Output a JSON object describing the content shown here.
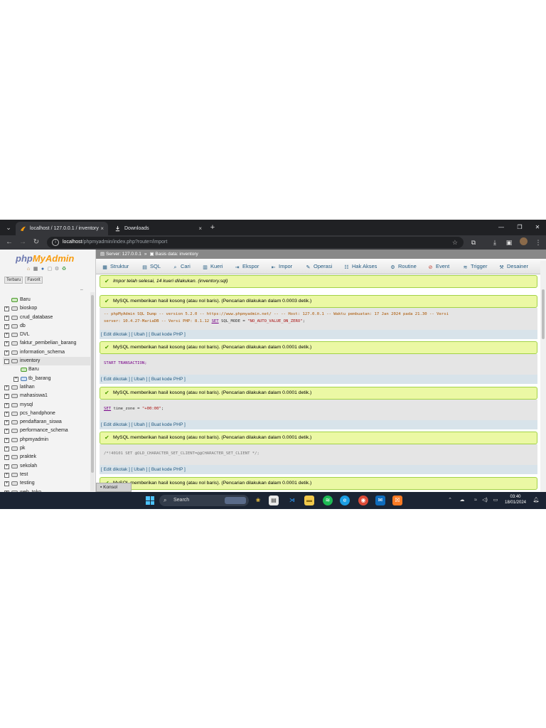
{
  "browser": {
    "tabs": [
      {
        "title": "localhost / 127.0.0.1 / inventory",
        "close": "×"
      },
      {
        "title": "Downloads",
        "close": "×"
      }
    ],
    "new_tab": "+",
    "window_controls": {
      "minimize": "—",
      "restore": "❐",
      "close": "✕"
    },
    "url_host": "localhost",
    "url_path": "/phpmyadmin/index.php?route=/import"
  },
  "pma": {
    "logo_php": "php",
    "logo_myadmin": "MyAdmin",
    "sidebar_tabs": [
      "Terbaru",
      "Favorit"
    ],
    "collapse": "⇔",
    "tree": [
      {
        "label": "Baru",
        "type": "new",
        "expander": ""
      },
      {
        "label": "bioskop",
        "type": "db",
        "expander": "+"
      },
      {
        "label": "crud_database",
        "type": "db",
        "expander": "+"
      },
      {
        "label": "db",
        "type": "db",
        "expander": "+"
      },
      {
        "label": "DVL",
        "type": "db",
        "expander": "+"
      },
      {
        "label": "faktur_pembelian_barang",
        "type": "db",
        "expander": "+"
      },
      {
        "label": "information_schema",
        "type": "db",
        "expander": "+"
      },
      {
        "label": "inventory",
        "type": "db-open",
        "expander": "−"
      },
      {
        "label": "Baru",
        "type": "child-new",
        "expander": ""
      },
      {
        "label": "tb_barang",
        "type": "child-table",
        "expander": "+"
      },
      {
        "label": "latihan",
        "type": "db",
        "expander": "+"
      },
      {
        "label": "mahasiswa1",
        "type": "db",
        "expander": "+"
      },
      {
        "label": "mysql",
        "type": "db",
        "expander": "+"
      },
      {
        "label": "pcs_handphone",
        "type": "db",
        "expander": "+"
      },
      {
        "label": "pendaftaran_siswa",
        "type": "db",
        "expander": "+"
      },
      {
        "label": "performance_schema",
        "type": "db",
        "expander": "+"
      },
      {
        "label": "phpmyadmin",
        "type": "db",
        "expander": "+"
      },
      {
        "label": "pk",
        "type": "db",
        "expander": "+"
      },
      {
        "label": "praktek",
        "type": "db",
        "expander": "+"
      },
      {
        "label": "sekolah",
        "type": "db",
        "expander": "+"
      },
      {
        "label": "test",
        "type": "db",
        "expander": "+"
      },
      {
        "label": "testing",
        "type": "db",
        "expander": "+"
      },
      {
        "label": "web_toko",
        "type": "db",
        "expander": "+"
      }
    ],
    "breadcrumb": {
      "server": "Server: 127.0.0.1",
      "database": "Basis data: inventory",
      "separator": "»"
    },
    "menu": [
      {
        "label": "Struktur",
        "icon": "structure-icon"
      },
      {
        "label": "SQL",
        "icon": "sql-icon"
      },
      {
        "label": "Cari",
        "icon": "search-icon"
      },
      {
        "label": "Kueri",
        "icon": "query-icon"
      },
      {
        "label": "Ekspor",
        "icon": "export-icon"
      },
      {
        "label": "Impor",
        "icon": "import-icon"
      },
      {
        "label": "Operasi",
        "icon": "wrench-icon"
      },
      {
        "label": "Hak Akses",
        "icon": "privileges-icon"
      },
      {
        "label": "Routine",
        "icon": "routine-icon"
      },
      {
        "label": "Event",
        "icon": "event-icon"
      },
      {
        "label": "Trigger",
        "icon": "trigger-icon"
      },
      {
        "label": "Desainer",
        "icon": "designer-icon"
      }
    ],
    "import_success": "Impor telah selesai, 14 kueri dilakukan. (inventory.sql)",
    "results": [
      {
        "message": "MySQL memberikan hasil kosong (atau nol baris). (Pencarian dilakukan dalam 0.0003 detik.)",
        "sql_line1": "-- phpMyAdmin SQL Dump -- version 5.2.0 -- https://www.phpmyadmin.net/ -- -- Host: 127.0.0.1 -- Waktu pembuatan: 17 Jan 2024 pada 21.30 -- Versi",
        "sql_line2_a": "server: 10.4.27-MariaDB -- Versi PHP: 8.1.12 ",
        "sql_line2_kw": "SET",
        "sql_line2_b": " SQL_MODE = ",
        "sql_line2_str": "\"NO_AUTO_VALUE_ON_ZERO\"",
        "sql_line2_end": ";"
      },
      {
        "message": "MySQL memberikan hasil kosong (atau nol baris). (Pencarian dilakukan dalam 0.0001 detik.)",
        "sql": "START TRANSACTION;"
      },
      {
        "message": "MySQL memberikan hasil kosong (atau nol baris). (Pencarian dilakukan dalam 0.0001 detik.)",
        "sql_kw": "SET",
        "sql_rest": " time_zone = ",
        "sql_str": "\"+00:00\"",
        "sql_end": ";"
      },
      {
        "message": "MySQL memberikan hasil kosong (atau nol baris). (Pencarian dilakukan dalam 0.0001 detik.)",
        "sql": "/*!40101 SET @OLD_CHARACTER_SET_CLIENT=@@CHARACTER_SET_CLIENT */;"
      },
      {
        "message": "MySQL memberikan hasil kosong (atau nol baris). (Pencarian dilakukan dalam 0.0001 detik.)"
      }
    ],
    "links": {
      "edit_inline": "Edit dikotak",
      "edit": "Ubah",
      "php_code": "Buat kode PHP",
      "open": "[ ",
      "mid": " ] [ ",
      "close": " ]"
    },
    "console": "Konsol"
  },
  "taskbar": {
    "search_placeholder": "Search",
    "time": "03:40",
    "date": "18/01/2024"
  }
}
